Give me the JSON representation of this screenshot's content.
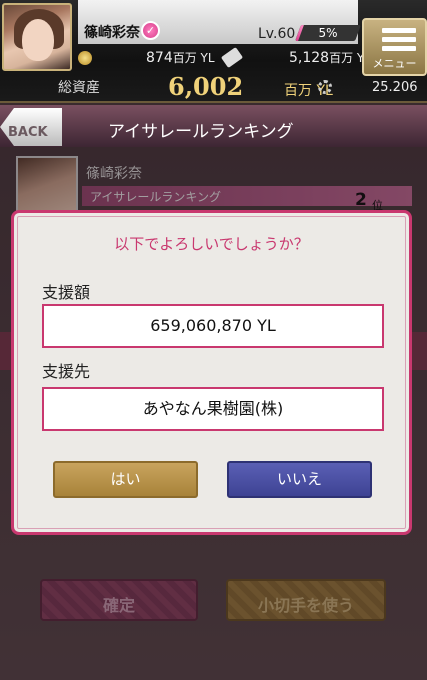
{
  "header": {
    "player_name": "篠崎彩奈",
    "level_label": "Lv.60",
    "level_percent_label": "5%",
    "level_progress": 0.05,
    "money_value": "874",
    "money_unit": "百万 YL",
    "ticket_value": "5,128",
    "ticket_unit": "百万 YL",
    "total_assets_label": "総資産",
    "total_assets_value": "6,002",
    "total_assets_unit": "百万 YL",
    "points_value": "25.206",
    "menu_label": "メニュー"
  },
  "titlebar": {
    "back_label": "BACK",
    "title": "アイサレールランキング"
  },
  "background": {
    "idol_name": "篠崎彩奈",
    "ranking_label": "アイサレールランキング",
    "rank_number": "2",
    "rank_unit": "位",
    "confirm_label": "確定",
    "check_label": "小切手を使う"
  },
  "modal": {
    "title": "以下でよろしいでしょうか？",
    "amount_label": "支援額",
    "amount_value": "659,060,870 YL",
    "recipient_label": "支援先",
    "recipient_value": "あやなん果樹園(株)",
    "yes_label": "はい",
    "no_label": "いいえ"
  }
}
